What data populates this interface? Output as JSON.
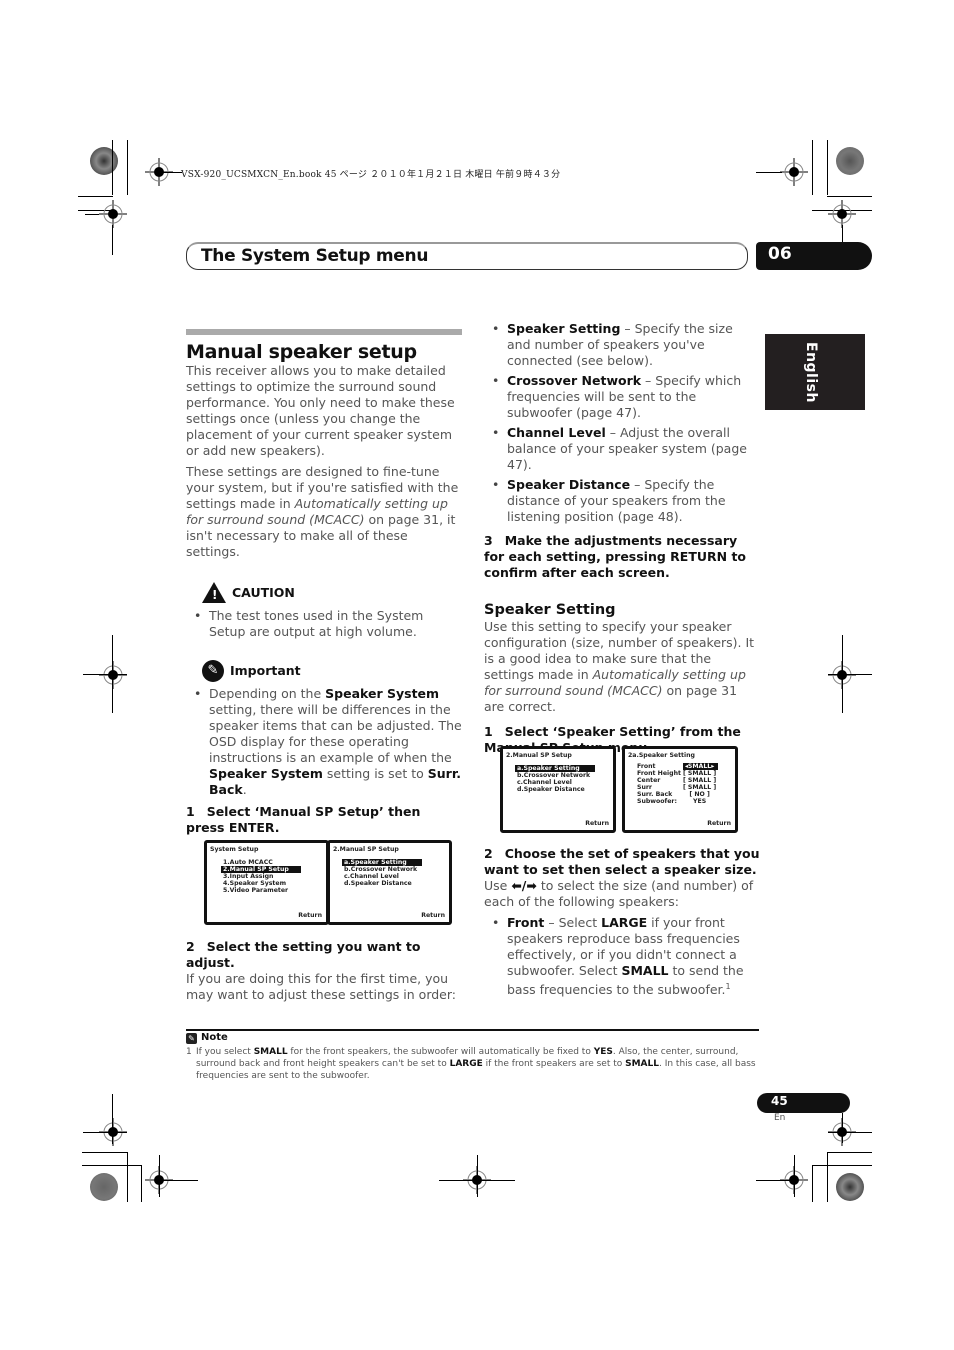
{
  "print_header": "VSX-920_UCSMXCN_En.book  45 ページ  ２０１０年１月２１日  木曜日  午前９時４３分",
  "header": {
    "title": "The System Setup menu",
    "chapter": "06"
  },
  "language_tab": "English",
  "left": {
    "section_title": "Manual speaker setup",
    "intro_p1": "This receiver allows you to make detailed settings to optimize the surround sound performance. You only need to make these settings once (unless you change the placement of your current speaker system or add new speakers).",
    "intro_p2_a": "These settings are designed to fine-tune your system, but if you're satisfied with the settings made in ",
    "intro_p2_i": "Automatically setting up for surround sound (MCACC)",
    "intro_p2_b": " on page 31, it isn't necessary to make all of these settings.",
    "caution": {
      "label": "CAUTION",
      "icon": "warning-triangle-icon",
      "item": "The test tones used in the System Setup are output at high volume."
    },
    "important": {
      "label": "Important",
      "icon": "pushpin-icon",
      "t1": "Depending on the ",
      "b1": "Speaker System",
      "t2": " setting, there will be differences in the speaker items that can be adjusted. The OSD display for these operating instructions is an example of when the ",
      "b2": "Speaker System",
      "t3": " setting is set to ",
      "b3": "Surr. Back",
      "t4": "."
    },
    "step1": {
      "num": "1",
      "text": "Select ‘Manual SP Setup’ then press ENTER."
    },
    "osd_system_setup": {
      "title": "System  Setup",
      "items": [
        "1.Auto  MCACC",
        "2.Manual  SP  Setup",
        "3.Input  Assign",
        "4.Speaker System",
        "5.Video Parameter"
      ],
      "selected": 1,
      "return": "Return"
    },
    "osd_manual_sp": {
      "title": "2.Manual  SP  Setup",
      "items": [
        "a.Speaker  Setting",
        "b.Crossover  Network",
        "c.Channel  Level",
        "d.Speaker  Distance"
      ],
      "selected": 0,
      "return": "Return"
    },
    "step2": {
      "num": "2",
      "text": "Select the setting you want to adjust."
    },
    "step2_body": "If you are doing this for the first time, you may want to adjust these settings in order:"
  },
  "right": {
    "settings_list": [
      {
        "name": "Speaker Setting",
        "desc": " – Specify the size and number of speakers you've connected (see below)."
      },
      {
        "name": "Crossover Network",
        "desc": " – Specify which frequencies will be sent to the subwoofer (page 47)."
      },
      {
        "name": "Channel Level",
        "desc": " – Adjust the overall balance of your speaker system (page 47)."
      },
      {
        "name": "Speaker Distance",
        "desc": " – Specify the distance of your speakers from the listening position (page 48)."
      }
    ],
    "step3": {
      "num": "3",
      "text": "Make the adjustments necessary for each setting, pressing RETURN to confirm after each screen."
    },
    "subsection_title": "Speaker Setting",
    "sub_p_a": "Use this setting to specify your speaker configuration (size, number of speakers). It is a good idea to make sure that the settings made in ",
    "sub_p_i": "Automatically setting up for surround sound (MCACC)",
    "sub_p_b": " on page 31 are correct.",
    "step1": {
      "num": "1",
      "text": "Select ‘Speaker Setting’ from the Manual SP Setup menu."
    },
    "osd_manual_sp": {
      "title": "2.Manual  SP  Setup",
      "items": [
        "a.Speaker  Setting",
        "b.Crossover  Network",
        "c.Channel  Level",
        "d.Speaker  Distance"
      ],
      "selected": 0,
      "return": "Return"
    },
    "osd_speaker_setting": {
      "title": "2a.Speaker  Setting",
      "rows": [
        {
          "label": "Front",
          "value": "SMALL",
          "selected": true
        },
        {
          "label": "Front Height",
          "value": "SMALL"
        },
        {
          "label": "Center",
          "value": "SMALL"
        },
        {
          "label": "Surr",
          "value": "SMALL"
        },
        {
          "label": "Surr. Back",
          "value": "NO"
        },
        {
          "label": "Subwoofer:",
          "value": "YES",
          "plain": true
        }
      ],
      "return": "Return"
    },
    "step2": {
      "num": "2",
      "text": "Choose the set of speakers that you want to set then select a speaker size."
    },
    "step2_body_a": "Use ",
    "step2_arrows": "⬅/➡",
    "step2_body_b": " to select the size (and number) of each of the following speakers:",
    "front": {
      "name": "Front",
      "t1": " – Select ",
      "b1": "LARGE",
      "t2": " if your front speakers reproduce bass frequencies effectively, or if you didn't connect a subwoofer. Select ",
      "b2": "SMALL",
      "t3": " to send the bass frequencies to the subwoofer.",
      "footnote_ref": "1"
    }
  },
  "note": {
    "label": "Note",
    "num": "1",
    "t1": "If you select ",
    "b1": "SMALL",
    "t2": " for the front speakers, the subwoofer will automatically be fixed to ",
    "b2": "YES",
    "t3": ". Also, the center, surround, surround back and front height speakers can't be set to ",
    "b3": "LARGE",
    "t4": " if the front speakers are set to ",
    "b4": "SMALL",
    "t5": ". In this case, all bass frequencies are sent to the subwoofer."
  },
  "footer": {
    "page": "45",
    "lang": "En"
  }
}
